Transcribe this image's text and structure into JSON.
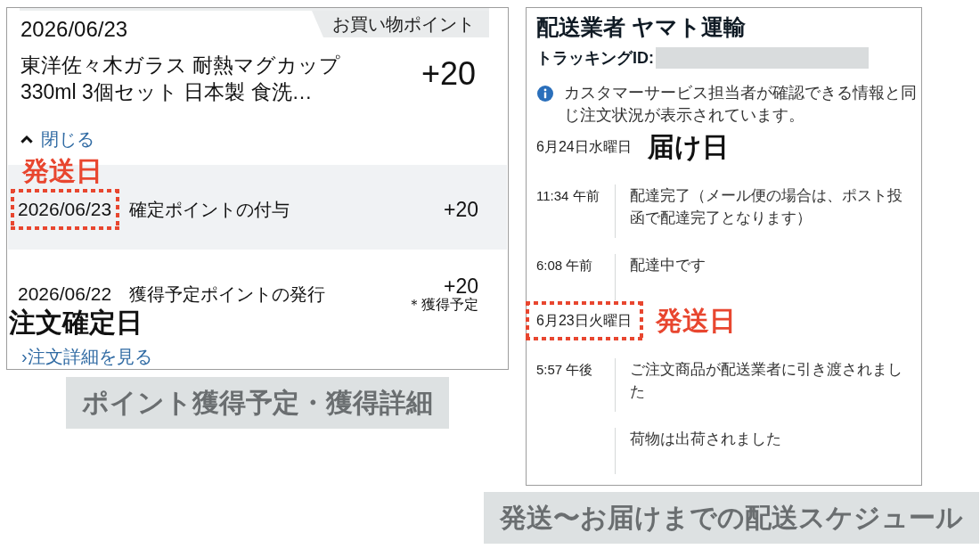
{
  "points_panel": {
    "date": "2026/06/23",
    "badge": "お買い物ポイント",
    "product_title": "東洋佐々木ガラス 耐熱マグカップ 330ml 3個セット 日本製 食洗…",
    "points": "+20",
    "collapse_link": "閉じる",
    "entries": [
      {
        "kind": "annotation",
        "text": "発送日",
        "color": "#e8462f"
      },
      {
        "kind": "history",
        "date": "2026/06/23",
        "description": "確定ポイントの付与",
        "points": "+20",
        "highlighted": true,
        "shaded": true
      },
      {
        "kind": "history",
        "date": "2026/06/22",
        "description": "獲得予定ポイントの発行",
        "points": "+20",
        "note": "＊獲得予定",
        "highlighted": false,
        "shaded": false
      },
      {
        "kind": "annotation",
        "text": "注文確定日",
        "color": "#111111"
      }
    ],
    "details_link": "›注文詳細を見る"
  },
  "points_caption": "ポイント獲得予定・獲得詳細",
  "delivery_panel": {
    "carrier": "配送業者 ヤマト運輸",
    "tracking_label": "トラッキングID:",
    "notice": "カスタマーサービス担当者が確認できる情報と同じ注文状況が表示されています。",
    "days": [
      {
        "date": "6月24日水曜日",
        "highlighted": false,
        "annotation": {
          "text": "届け日",
          "color": "#111111"
        },
        "events": [
          {
            "time": "11:34 午前",
            "description": "配達完了（メール便の場合は、ポスト投函で配達完了となります）"
          },
          {
            "time": "6:08 午前",
            "description": "配達中です"
          }
        ]
      },
      {
        "date": "6月23日火曜日",
        "highlighted": true,
        "annotation": {
          "text": "発送日",
          "color": "#e8462f"
        },
        "events": [
          {
            "time": "5:57 午後",
            "description": "ご注文商品が配送業者に引き渡されました"
          },
          {
            "description": "荷物は出荷されました"
          }
        ]
      }
    ]
  },
  "delivery_caption": "発送〜お届けまでの配送スケジュール"
}
